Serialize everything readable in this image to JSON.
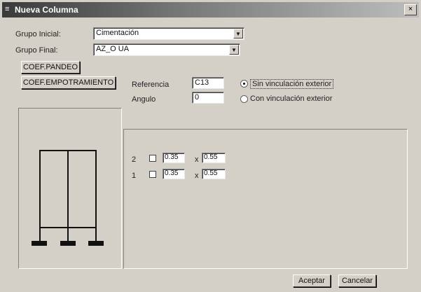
{
  "window": {
    "title": "Nueva Columna",
    "close_glyph": "×",
    "icon": "menu-icon"
  },
  "grupo_inicial": {
    "label": "Grupo Inicial:",
    "value": "Cimentación"
  },
  "grupo_final": {
    "label": "Grupo Final:",
    "value": "AZ_O UA"
  },
  "buttons": {
    "coef_pandeo": "COEF.PANDEO",
    "coef_empotramiento": "COEF.EMPOTRAMIENTO",
    "aceptar": "Aceptar",
    "cancelar": "Cancelar"
  },
  "referencia": {
    "label": "Referencia",
    "value": "C13"
  },
  "angulo": {
    "label": "Angulo",
    "value": "0"
  },
  "vinculacion": {
    "sin": "Sin vinculación exterior",
    "con": "Con vinculación exterior",
    "selected": "sin"
  },
  "plantas": [
    {
      "num": "2",
      "dim_a": "0.35",
      "x": "x",
      "dim_b": "0.55"
    },
    {
      "num": "1",
      "dim_a": "0.35",
      "x": "x",
      "dim_b": "0.55"
    }
  ]
}
